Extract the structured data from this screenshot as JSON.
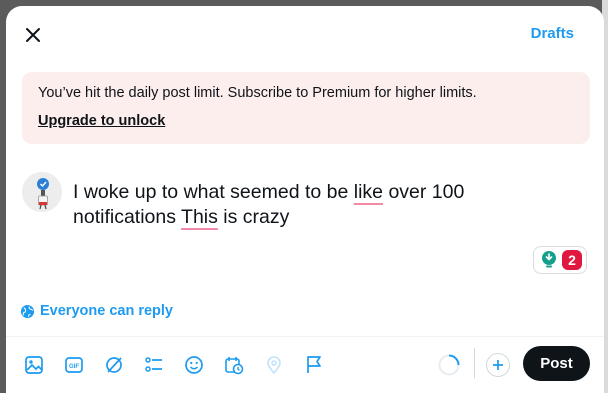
{
  "header": {
    "close_icon": "close-icon",
    "drafts_label": "Drafts"
  },
  "banner": {
    "message": "You’ve hit the daily post limit. Subscribe to Premium for higher limits.",
    "link_label": "Upgrade to unlock"
  },
  "composer": {
    "text_parts": [
      "I woke up to what seemed to be ",
      "like",
      " over 100",
      "notifications ",
      "This",
      " is crazy"
    ],
    "spell_flagged": [
      "like",
      "This"
    ]
  },
  "grammar": {
    "icon": "lightbulb-icon",
    "count": "2"
  },
  "reply": {
    "icon": "globe-icon",
    "label": "Everyone can reply"
  },
  "toolbar": {
    "icons": [
      "image-icon",
      "gif-icon",
      "grok-icon",
      "poll-icon",
      "emoji-icon",
      "schedule-icon",
      "location-icon",
      "flag-icon"
    ],
    "post_label": "Post"
  },
  "colors": {
    "accent": "#1d9bf0",
    "banner_bg": "#fdeeee",
    "post_button": "#0f1419",
    "spell_underline": "#f18aa7",
    "grammar_badge": "#e0173f"
  }
}
